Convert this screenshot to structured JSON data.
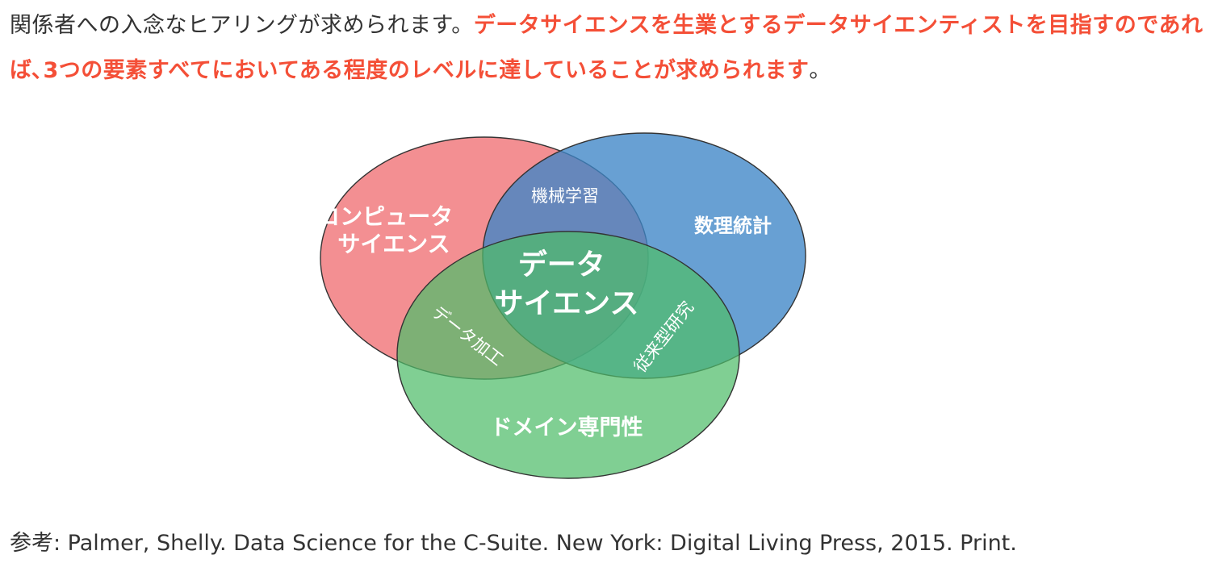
{
  "paragraph": {
    "normal_text": "関係者への入念なヒアリングが求められます。",
    "emphasis_text": "データサイエンスを生業とするデータサイエンティストを目指すのであれば､3つの要素すべてにおいてある程度のレベルに達していることが求められます",
    "end_punct": "。"
  },
  "venn": {
    "circles": [
      {
        "id": "computer_science",
        "label_lines": [
          "コンピュータ",
          "サイエンス"
        ],
        "color": "#ef6f73"
      },
      {
        "id": "statistics",
        "label_lines": [
          "数理統計"
        ],
        "color": "#3d85c6"
      },
      {
        "id": "domain",
        "label_lines": [
          "ドメイン専門性"
        ],
        "color": "#4fbd6a"
      }
    ],
    "intersections": {
      "cs_stats": "機械学習",
      "cs_domain": "データ加工",
      "stats_domain": "従来型研究",
      "center": [
        "データ",
        "サイエンス"
      ]
    }
  },
  "reference": "参考: Palmer, Shelly. Data Science for the C-Suite. New York: Digital Living Press, 2015. Print."
}
